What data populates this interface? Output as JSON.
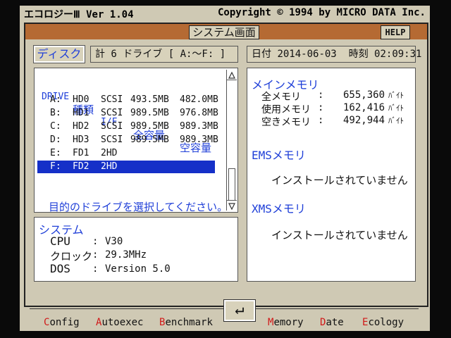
{
  "app": {
    "title": "エコロジーⅢ Ver 1.04",
    "copyright": "Copyright © 1994 by MICRO DATA Inc."
  },
  "header": {
    "screen_title": "システム画面",
    "help_label": "HELP"
  },
  "disk": {
    "button_label": "ディスク",
    "drive_count": "計 6 ドライブ [ A:～F: ]"
  },
  "datetime": {
    "date_label": "日付",
    "date": "2014-06-03",
    "time_label": "時刻",
    "time": "02:09:31"
  },
  "drives": {
    "columns": [
      "DRIVE",
      "種類",
      "I/F",
      "全容量",
      "空容量"
    ],
    "rows": [
      {
        "drive": "A:",
        "type": "HD0",
        "if": "SCSI",
        "total": "493.5MB",
        "free": "482.0MB"
      },
      {
        "drive": "B:",
        "type": "HD1",
        "if": "SCSI",
        "total": "989.5MB",
        "free": "976.8MB"
      },
      {
        "drive": "C:",
        "type": "HD2",
        "if": "SCSI",
        "total": "989.5MB",
        "free": "989.3MB"
      },
      {
        "drive": "D:",
        "type": "HD3",
        "if": "SCSI",
        "total": "989.5MB",
        "free": "989.3MB"
      },
      {
        "drive": "E:",
        "type": "FD1",
        "if": "2HD",
        "total": "",
        "free": ""
      },
      {
        "drive": "F:",
        "type": "FD2",
        "if": "2HD",
        "total": "",
        "free": ""
      }
    ],
    "selected_index": 5,
    "prompt": "目的のドライブを選択してください。"
  },
  "system": {
    "title": "システム",
    "cpu_label": "CPU",
    "cpu": "V30",
    "clock_label": "クロック",
    "clock": "29.3MHz",
    "dos_label": "DOS",
    "dos": "Version 5.0"
  },
  "memory": {
    "main_title": "メインメモリ",
    "total_label": "全メモリ",
    "total": "655,360",
    "used_label": "使用メモリ",
    "used": "162,416",
    "free_label": "空きメモリ",
    "free": "492,944",
    "unit": "ﾊﾞｲﾄ",
    "ems_title": "EMSメモリ",
    "ems_status": "インストールされていません",
    "xms_title": "XMSメモリ",
    "xms_status": "インストールされていません"
  },
  "menu": {
    "config": {
      "hot": "C",
      "rest": "onfig"
    },
    "autoexec": {
      "hot": "A",
      "rest": "utoexec"
    },
    "benchmark": {
      "hot": "B",
      "rest": "enchmark"
    },
    "enter": "↵",
    "memory": {
      "hot": "M",
      "rest": "emory"
    },
    "date": {
      "hot": "D",
      "rest": "ate"
    },
    "ecology": {
      "hot": "E",
      "rest": "cology"
    }
  },
  "colors": {
    "accent_blue": "#1f3fd8",
    "selection_blue": "#1530c8",
    "header_brown": "#b56a33",
    "hotkey_red": "#d01818",
    "panel_bg": "#cfc9b4"
  }
}
